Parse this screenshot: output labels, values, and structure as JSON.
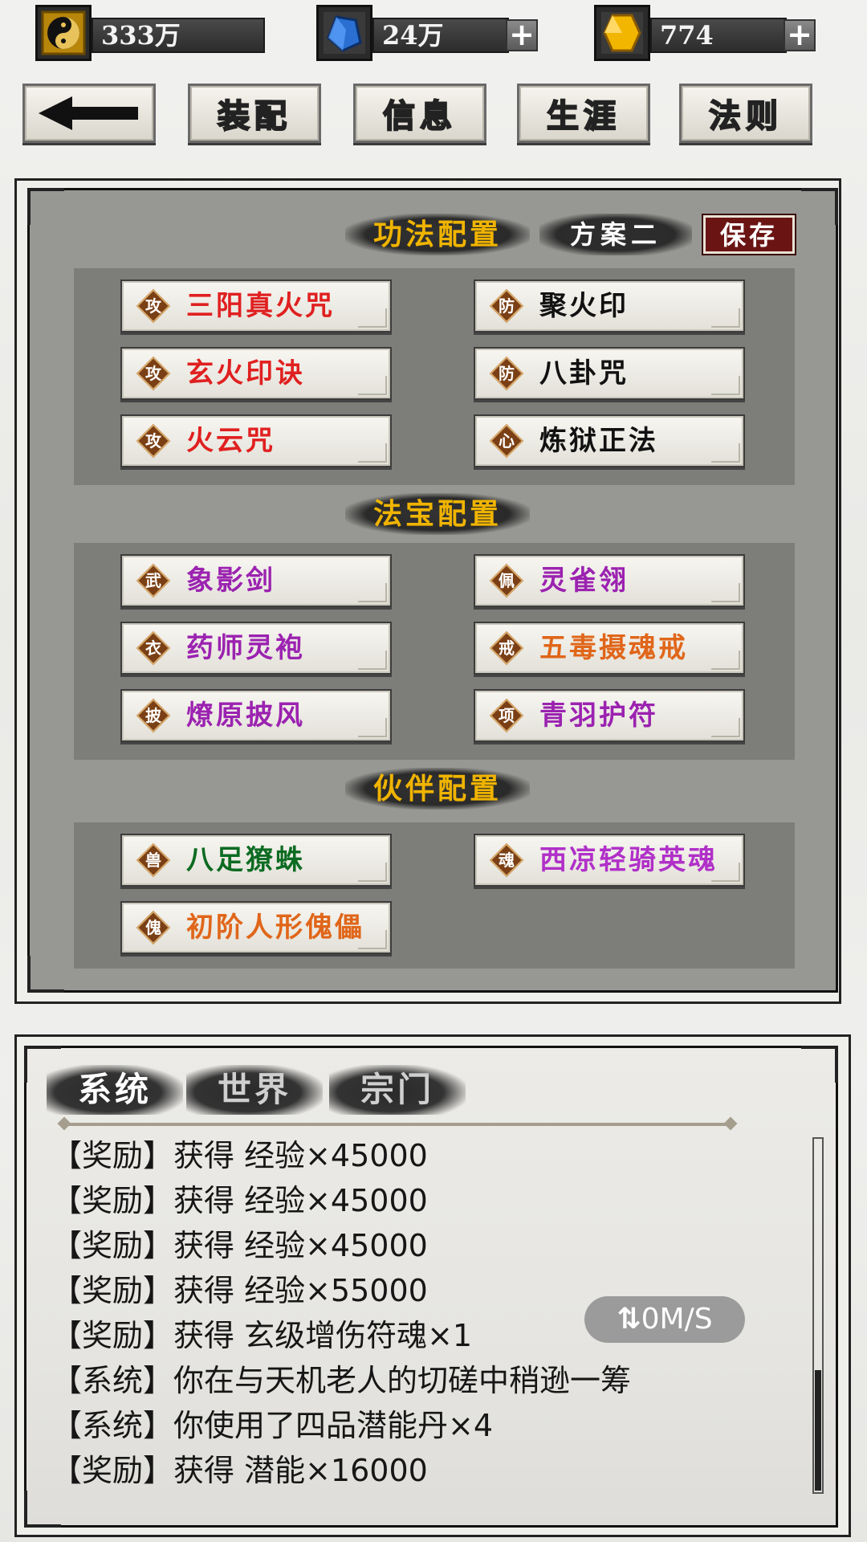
{
  "resources": [
    {
      "icon": "yin-yang-icon",
      "value": "333万",
      "has_plus": false
    },
    {
      "icon": "blue-crystal-icon",
      "value": "24万",
      "has_plus": true
    },
    {
      "icon": "gold-gem-icon",
      "value": "774",
      "has_plus": true
    }
  ],
  "plus_symbol": "+",
  "nav": {
    "back_icon": "back-arrow-icon",
    "tabs": [
      "装配",
      "信息",
      "生涯",
      "法则"
    ],
    "active_tab": "装配"
  },
  "skills": {
    "title": "功法配置",
    "plan": "方案二",
    "save": "保存",
    "items": [
      {
        "tag": "攻",
        "name": "三阳真火咒",
        "color": "#e02020"
      },
      {
        "tag": "防",
        "name": "聚火印",
        "color": "#111111"
      },
      {
        "tag": "攻",
        "name": "玄火印诀",
        "color": "#e02020"
      },
      {
        "tag": "防",
        "name": "八卦咒",
        "color": "#111111"
      },
      {
        "tag": "攻",
        "name": "火云咒",
        "color": "#e02020"
      },
      {
        "tag": "心",
        "name": "炼狱正法",
        "color": "#111111"
      }
    ]
  },
  "treasures": {
    "title": "法宝配置",
    "items": [
      {
        "tag": "武",
        "name": "象影剑",
        "color": "#9b22b0"
      },
      {
        "tag": "佩",
        "name": "灵雀翎",
        "color": "#9b22b0"
      },
      {
        "tag": "衣",
        "name": "药师灵袍",
        "color": "#9b22b0"
      },
      {
        "tag": "戒",
        "name": "五毒摄魂戒",
        "color": "#e0661a"
      },
      {
        "tag": "披",
        "name": "燎原披风",
        "color": "#9b22b0"
      },
      {
        "tag": "项",
        "name": "青羽护符",
        "color": "#9b22b0"
      }
    ]
  },
  "partners": {
    "title": "伙伴配置",
    "items": [
      {
        "tag": "兽",
        "name": "八足獠蛛",
        "color": "#0d6b22"
      },
      {
        "tag": "魂",
        "name": "西凉轻骑英魂",
        "color": "#b030c8"
      },
      {
        "tag": "傀",
        "name": "初阶人形傀儡",
        "color": "#e0661a"
      }
    ]
  },
  "chat": {
    "tabs": [
      "系统",
      "世界",
      "宗门"
    ],
    "active_tab": "系统",
    "lines": [
      "【奖励】获得 经验×45000",
      "【奖励】获得 经验×45000",
      "【奖励】获得 经验×45000",
      "【奖励】获得 经验×55000",
      "【奖励】获得 玄级增伤符魂×1",
      "【系统】你在与天机老人的切磋中稍逊一筹",
      "【系统】你使用了四品潜能丹×4",
      "【奖励】获得 潜能×16000"
    ],
    "net_speed": "0M/S",
    "net_icon": "sync-arrows-icon"
  }
}
